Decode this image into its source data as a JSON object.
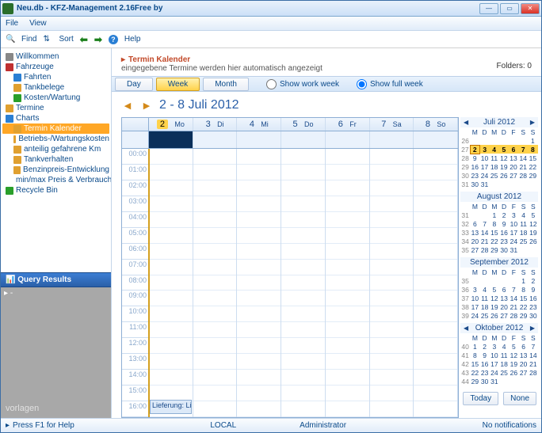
{
  "window": {
    "title": "Neu.db - KFZ-Management 2.16Free by"
  },
  "menubar": {
    "file": "File",
    "view": "View"
  },
  "toolbar": {
    "find": "Find",
    "sort": "Sort",
    "help": "Help"
  },
  "tree": {
    "items": [
      {
        "label": "Willkommen",
        "lvl": 0,
        "ico": "gray"
      },
      {
        "label": "Fahrzeuge",
        "lvl": 0,
        "ico": "red"
      },
      {
        "label": "Fahrten",
        "lvl": 1,
        "ico": "blue"
      },
      {
        "label": "Tankbelege",
        "lvl": 1,
        "ico": "default"
      },
      {
        "label": "Kosten/Wartung",
        "lvl": 1,
        "ico": "green"
      },
      {
        "label": "Termine",
        "lvl": 0,
        "ico": "default"
      },
      {
        "label": "Charts",
        "lvl": 0,
        "ico": "blue"
      },
      {
        "label": "Termin Kalender",
        "lvl": 1,
        "ico": "default",
        "sel": true
      },
      {
        "label": "Betriebs-/Wartungskosten",
        "lvl": 1,
        "ico": "default"
      },
      {
        "label": "anteilig gefahrene Km",
        "lvl": 1,
        "ico": "default"
      },
      {
        "label": "Tankverhalten",
        "lvl": 1,
        "ico": "default"
      },
      {
        "label": "Benzinpreis-Entwicklung",
        "lvl": 1,
        "ico": "default"
      },
      {
        "label": "min/max Preis & Verbrauch",
        "lvl": 1,
        "ico": "default"
      },
      {
        "label": "Recycle Bin",
        "lvl": 0,
        "ico": "green"
      }
    ]
  },
  "query": {
    "header": "Query Results",
    "body": "-"
  },
  "watermark": "vorlagen",
  "main": {
    "title": "Termin Kalender",
    "subtitle": "eingegebene Termine werden hier automatisch angezeigt",
    "folders": "Folders: 0"
  },
  "viewtabs": {
    "day": "Day",
    "week": "Week",
    "month": "Month"
  },
  "radios": {
    "workweek": "Show work week",
    "fullweek": "Show full week"
  },
  "range": "2 - 8 Juli 2012",
  "week": {
    "days": [
      {
        "n": "2",
        "d": "Mo",
        "active": true
      },
      {
        "n": "3",
        "d": "Di"
      },
      {
        "n": "4",
        "d": "Mi"
      },
      {
        "n": "5",
        "d": "Do"
      },
      {
        "n": "6",
        "d": "Fr"
      },
      {
        "n": "7",
        "d": "Sa"
      },
      {
        "n": "8",
        "d": "So"
      }
    ],
    "hours": [
      "00:00",
      "01:00",
      "02:00",
      "03:00",
      "04:00",
      "05:00",
      "06:00",
      "07:00",
      "08:00",
      "09:00",
      "10:00",
      "11:00",
      "12:00",
      "13:00",
      "14:00",
      "15:00",
      "16:00"
    ],
    "event": {
      "label": "Lieferung: Li",
      "hourIndex": 16
    }
  },
  "miniCals": [
    {
      "title": "Juli 2012",
      "nav": true,
      "head": [
        "",
        "M",
        "D",
        "M",
        "D",
        "F",
        "S",
        "S"
      ],
      "rows": [
        [
          "26",
          "",
          "",
          "",
          "",
          "",
          "",
          "1"
        ],
        [
          "27",
          "2",
          "3",
          "4",
          "5",
          "6",
          "7",
          "8"
        ],
        [
          "28",
          "9",
          "10",
          "11",
          "12",
          "13",
          "14",
          "15"
        ],
        [
          "29",
          "16",
          "17",
          "18",
          "19",
          "20",
          "21",
          "22"
        ],
        [
          "30",
          "23",
          "24",
          "25",
          "26",
          "27",
          "28",
          "29"
        ],
        [
          "31",
          "30",
          "31",
          "",
          "",
          "",
          "",
          ""
        ]
      ],
      "hlRow": 1
    },
    {
      "title": "August 2012",
      "head": [
        "",
        "M",
        "D",
        "M",
        "D",
        "F",
        "S",
        "S"
      ],
      "rows": [
        [
          "31",
          "",
          "",
          "1",
          "2",
          "3",
          "4",
          "5"
        ],
        [
          "32",
          "6",
          "7",
          "8",
          "9",
          "10",
          "11",
          "12"
        ],
        [
          "33",
          "13",
          "14",
          "15",
          "16",
          "17",
          "18",
          "19"
        ],
        [
          "34",
          "20",
          "21",
          "22",
          "23",
          "24",
          "25",
          "26"
        ],
        [
          "35",
          "27",
          "28",
          "29",
          "30",
          "31",
          "",
          ""
        ]
      ]
    },
    {
      "title": "September 2012",
      "head": [
        "",
        "M",
        "D",
        "M",
        "D",
        "F",
        "S",
        "S"
      ],
      "rows": [
        [
          "35",
          "",
          "",
          "",
          "",
          "",
          "1",
          "2"
        ],
        [
          "36",
          "3",
          "4",
          "5",
          "6",
          "7",
          "8",
          "9"
        ],
        [
          "37",
          "10",
          "11",
          "12",
          "13",
          "14",
          "15",
          "16"
        ],
        [
          "38",
          "17",
          "18",
          "19",
          "20",
          "21",
          "22",
          "23"
        ],
        [
          "39",
          "24",
          "25",
          "26",
          "27",
          "28",
          "29",
          "30"
        ]
      ]
    },
    {
      "title": "Oktober 2012",
      "nav": true,
      "head": [
        "",
        "M",
        "D",
        "M",
        "D",
        "F",
        "S",
        "S"
      ],
      "rows": [
        [
          "40",
          "1",
          "2",
          "3",
          "4",
          "5",
          "6",
          "7"
        ],
        [
          "41",
          "8",
          "9",
          "10",
          "11",
          "12",
          "13",
          "14"
        ],
        [
          "42",
          "15",
          "16",
          "17",
          "18",
          "19",
          "20",
          "21"
        ],
        [
          "43",
          "22",
          "23",
          "24",
          "25",
          "26",
          "27",
          "28"
        ],
        [
          "44",
          "29",
          "30",
          "31",
          "",
          "",
          "",
          ""
        ]
      ]
    }
  ],
  "miniBtns": {
    "today": "Today",
    "none": "None"
  },
  "status": {
    "help": "Press F1 for Help",
    "local": "LOCAL",
    "admin": "Administrator",
    "notif": "No notifications"
  }
}
